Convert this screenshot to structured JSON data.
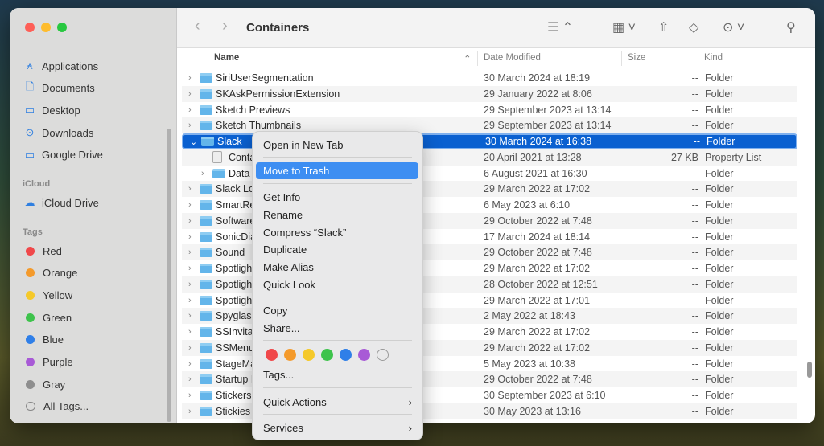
{
  "window": {
    "title": "Containers"
  },
  "sidebar": {
    "items": [
      {
        "label": "Applications",
        "icon": "applications-icon"
      },
      {
        "label": "Documents",
        "icon": "document-icon"
      },
      {
        "label": "Desktop",
        "icon": "desktop-icon"
      },
      {
        "label": "Downloads",
        "icon": "downloads-icon"
      },
      {
        "label": "Google Drive",
        "icon": "folder-icon"
      }
    ],
    "icloud_header": "iCloud",
    "icloud_drive": "iCloud Drive",
    "tags_header": "Tags",
    "tags": [
      {
        "label": "Red",
        "color": "#f0484a"
      },
      {
        "label": "Orange",
        "color": "#f49a2b"
      },
      {
        "label": "Yellow",
        "color": "#f5c92a"
      },
      {
        "label": "Green",
        "color": "#3ec34c"
      },
      {
        "label": "Blue",
        "color": "#2f7fe8"
      },
      {
        "label": "Purple",
        "color": "#a85ad6"
      },
      {
        "label": "Gray",
        "color": "#8e8e8e"
      }
    ],
    "all_tags": "All Tags..."
  },
  "columns": {
    "name": "Name",
    "date": "Date Modified",
    "size": "Size",
    "kind": "Kind"
  },
  "rows": [
    {
      "name": "SiriUserSegmentation",
      "date": "30 March 2024 at 18:19",
      "size": "--",
      "kind": "Folder"
    },
    {
      "name": "SKAskPermissionExtension",
      "date": "29 January 2022 at 8:06",
      "size": "--",
      "kind": "Folder"
    },
    {
      "name": "Sketch Previews",
      "date": "29 September 2023 at 13:14",
      "size": "--",
      "kind": "Folder"
    },
    {
      "name": "Sketch Thumbnails",
      "date": "29 September 2023 at 13:14",
      "size": "--",
      "kind": "Folder"
    },
    {
      "name": "Slack",
      "date": "30 March 2024 at 16:38",
      "size": "--",
      "kind": "Folder",
      "selected": true,
      "expanded": true
    },
    {
      "name": "Conta",
      "date": "20 April 2021 at 13:28",
      "size": "27 KB",
      "kind": "Property List",
      "child": true,
      "file": true
    },
    {
      "name": "Data",
      "date": "6 August 2021 at 16:30",
      "size": "--",
      "kind": "Folder",
      "child": true
    },
    {
      "name": "Slack Lo",
      "date": "29 March 2022 at 17:02",
      "size": "--",
      "kind": "Folder"
    },
    {
      "name": "SmartRe",
      "date": "6 May 2023 at 6:10",
      "size": "--",
      "kind": "Folder"
    },
    {
      "name": "Software",
      "date": "29 October 2022 at 7:48",
      "size": "--",
      "kind": "Folder"
    },
    {
      "name": "SonicDia",
      "date": "17 March 2024 at 18:14",
      "size": "--",
      "kind": "Folder"
    },
    {
      "name": "Sound",
      "date": "29 October 2022 at 7:48",
      "size": "--",
      "kind": "Folder"
    },
    {
      "name": "Spotligh",
      "date": "29 March 2022 at 17:02",
      "size": "--",
      "kind": "Folder"
    },
    {
      "name": "Spotligh",
      "date": "28 October 2022 at 12:51",
      "size": "--",
      "kind": "Folder"
    },
    {
      "name": "Spotligh",
      "date": "29 March 2022 at 17:01",
      "size": "--",
      "kind": "Folder"
    },
    {
      "name": "Spyglass",
      "date": "2 May 2022 at 18:43",
      "size": "--",
      "kind": "Folder"
    },
    {
      "name": "SSInvitat",
      "date": "29 March 2022 at 17:02",
      "size": "--",
      "kind": "Folder"
    },
    {
      "name": "SSMenu",
      "date": "29 March 2022 at 17:02",
      "size": "--",
      "kind": "Folder"
    },
    {
      "name": "StageMa",
      "date": "5 May 2023 at 10:38",
      "size": "--",
      "kind": "Folder"
    },
    {
      "name": "Startup I",
      "date": "29 October 2022 at 7:48",
      "size": "--",
      "kind": "Folder"
    },
    {
      "name": "Stickers",
      "date": "30 September 2023 at 6:10",
      "size": "--",
      "kind": "Folder"
    },
    {
      "name": "Stickies",
      "date": "30 May 2023 at 13:16",
      "size": "--",
      "kind": "Folder"
    }
  ],
  "menu": {
    "open_new_tab": "Open in New Tab",
    "move_to_trash": "Move to Trash",
    "get_info": "Get Info",
    "rename": "Rename",
    "compress": "Compress “Slack”",
    "duplicate": "Duplicate",
    "make_alias": "Make Alias",
    "quick_look": "Quick Look",
    "copy": "Copy",
    "share": "Share...",
    "tags": "Tags...",
    "quick_actions": "Quick Actions",
    "services": "Services",
    "tag_colors": [
      "#f0484a",
      "#f49a2b",
      "#f5c92a",
      "#3ec34c",
      "#2f7fe8",
      "#a85ad6",
      "transparent"
    ]
  }
}
